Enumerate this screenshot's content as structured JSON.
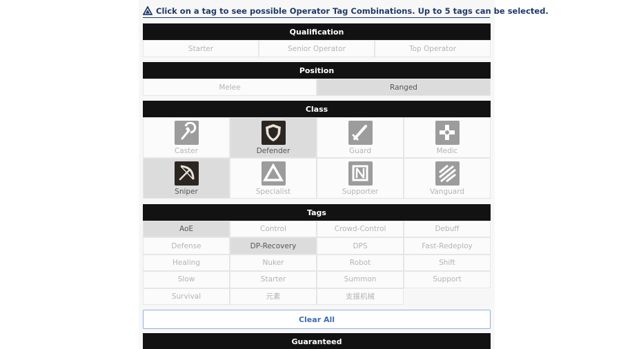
{
  "notice": "Click on a tag to see possible Operator Tag Combinations. Up to 5 tags can be selected.",
  "qualification": {
    "title": "Qualification",
    "options": [
      {
        "label": "Starter",
        "selected": false
      },
      {
        "label": "Senior Operator",
        "selected": false
      },
      {
        "label": "Top Operator",
        "selected": false
      }
    ]
  },
  "position": {
    "title": "Position",
    "options": [
      {
        "label": "Melee",
        "selected": false
      },
      {
        "label": "Ranged",
        "selected": true
      }
    ]
  },
  "class": {
    "title": "Class",
    "options": [
      {
        "label": "Caster",
        "selected": false,
        "icon": "caster-icon"
      },
      {
        "label": "Defender",
        "selected": true,
        "icon": "defender-icon"
      },
      {
        "label": "Guard",
        "selected": false,
        "icon": "guard-icon"
      },
      {
        "label": "Medic",
        "selected": false,
        "icon": "medic-icon"
      },
      {
        "label": "Sniper",
        "selected": true,
        "icon": "sniper-icon"
      },
      {
        "label": "Specialist",
        "selected": false,
        "icon": "specialist-icon"
      },
      {
        "label": "Supporter",
        "selected": false,
        "icon": "supporter-icon"
      },
      {
        "label": "Vanguard",
        "selected": false,
        "icon": "vanguard-icon"
      }
    ]
  },
  "tags": {
    "title": "Tags",
    "options": [
      {
        "label": "AoE",
        "selected": true
      },
      {
        "label": "Control",
        "selected": false
      },
      {
        "label": "Crowd-Control",
        "selected": false
      },
      {
        "label": "Debuff",
        "selected": false
      },
      {
        "label": "Defense",
        "selected": false
      },
      {
        "label": "DP-Recovery",
        "selected": true
      },
      {
        "label": "DPS",
        "selected": false
      },
      {
        "label": "Fast-Redeploy",
        "selected": false
      },
      {
        "label": "Healing",
        "selected": false
      },
      {
        "label": "Nuker",
        "selected": false
      },
      {
        "label": "Robot",
        "selected": false
      },
      {
        "label": "Shift",
        "selected": false
      },
      {
        "label": "Slow",
        "selected": false
      },
      {
        "label": "Starter",
        "selected": false
      },
      {
        "label": "Summon",
        "selected": false
      },
      {
        "label": "Support",
        "selected": false
      },
      {
        "label": "Survival",
        "selected": false
      },
      {
        "label": "元素",
        "selected": false
      },
      {
        "label": "支援机械",
        "selected": false
      }
    ]
  },
  "clear_all": "Clear All",
  "guaranteed": {
    "title": "Guaranteed"
  },
  "colors": {
    "header_bg": "#121212",
    "selected_bg": "#dcdcdc",
    "accent": "#3b6cb0"
  }
}
